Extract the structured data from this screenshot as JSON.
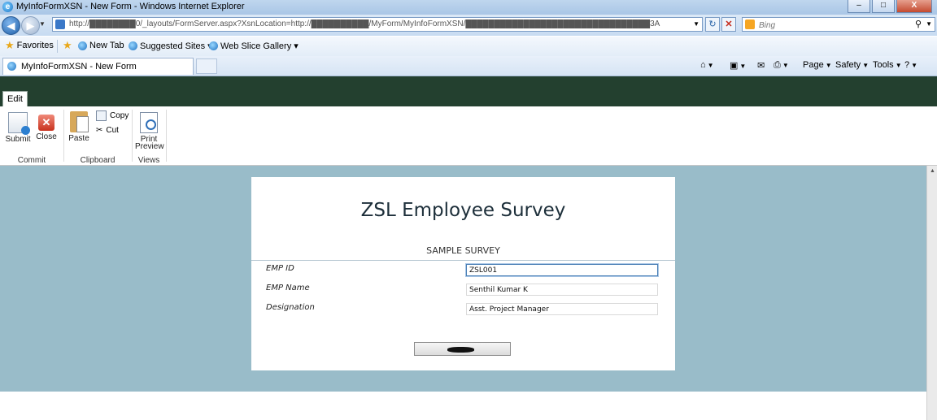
{
  "window": {
    "title": "MyInfoFormXSN - New Form - Windows Internet Explorer",
    "controls": [
      "–",
      "□",
      "X"
    ]
  },
  "address_bar": {
    "url": "http://████████0/_layouts/FormServer.aspx?XsnLocation=http://██████████/MyForm/MyInfoFormXSN/████████████████████████████████3A",
    "search_placeholder": "Bing"
  },
  "favorites_bar": {
    "favorites_label": "Favorites",
    "items": [
      {
        "label": "New Tab"
      },
      {
        "label": "Suggested Sites ▾"
      },
      {
        "label": "Web Slice Gallery ▾"
      }
    ]
  },
  "tabs": [
    {
      "label": "MyInfoFormXSN - New Form"
    }
  ],
  "command_bar": {
    "page": "Page",
    "safety": "Safety",
    "tools": "Tools"
  },
  "ribbon": {
    "active_tab": "Edit",
    "buttons": {
      "submit": "Submit",
      "close": "Close",
      "paste": "Paste",
      "copy": "Copy",
      "cut": "Cut",
      "print_preview_1": "Print",
      "print_preview_2": "Preview"
    },
    "groups": {
      "commit": "Commit",
      "clipboard": "Clipboard",
      "views": "Views"
    }
  },
  "form": {
    "title": "ZSL Employee Survey",
    "section": "SAMPLE SURVEY",
    "fields": [
      {
        "label": "EMP ID",
        "value": "ZSL001"
      },
      {
        "label": "EMP Name",
        "value": "Senthil Kumar K"
      },
      {
        "label": "Designation",
        "value": "Asst. Project Manager"
      }
    ]
  },
  "colors": {
    "ribbon_dark": "#23402f",
    "content_background": "#99bcc9",
    "form_background": "#ffffff"
  }
}
